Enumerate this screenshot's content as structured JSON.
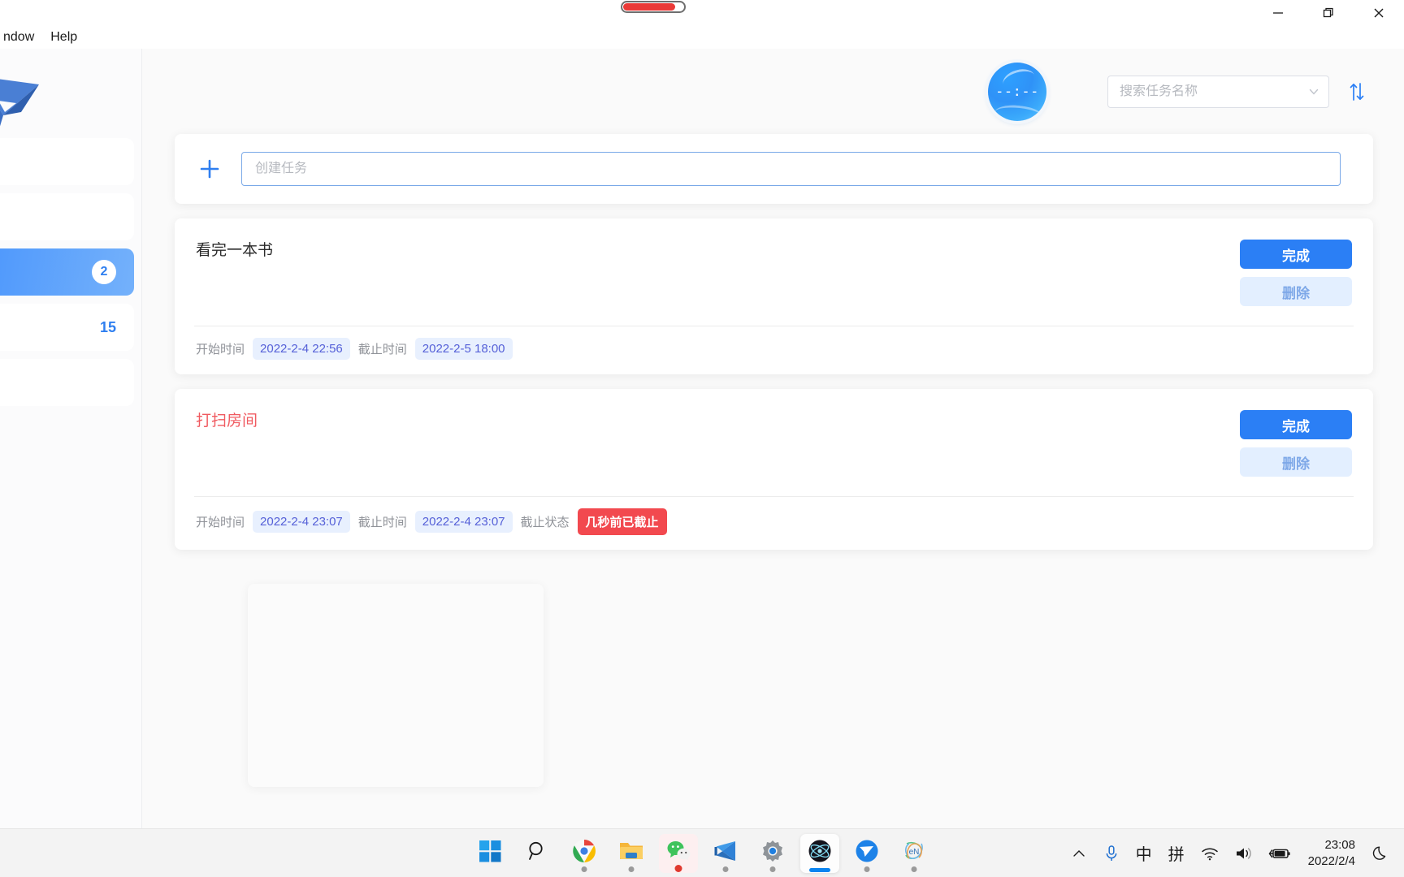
{
  "window": {
    "progress_pill_percent": 80,
    "controls": {
      "minimize": "minimize-icon",
      "restore": "restore-icon",
      "close": "close-icon"
    }
  },
  "menubar": {
    "items": [
      {
        "label": "ndow"
      },
      {
        "label": "Help"
      }
    ]
  },
  "sidebar": {
    "logo": "app-logo",
    "items": [
      {
        "label": "",
        "count": ""
      },
      {
        "label": "",
        "count": ""
      },
      {
        "label": "",
        "count": "2",
        "active": true
      },
      {
        "label": "",
        "count": "15"
      },
      {
        "label": "",
        "count": ""
      }
    ]
  },
  "topbar": {
    "clock_time": "--:--",
    "search": {
      "value": "",
      "placeholder": "搜索任务名称"
    },
    "sort_icon": "sort-arrows-icon",
    "chevron_icon": "chevron-down-icon"
  },
  "create": {
    "plus_icon": "plus-icon",
    "input_value": "",
    "input_placeholder": "创建任务"
  },
  "tasks": [
    {
      "title": "看完一本书",
      "overdue": false,
      "complete_label": "完成",
      "delete_label": "删除",
      "start_label": "开始时间",
      "start_value": "2022-2-4 22:56",
      "due_label": "截止时间",
      "due_value": "2022-2-5 18:00",
      "status_label": "",
      "status_value": ""
    },
    {
      "title": "打扫房间",
      "overdue": true,
      "complete_label": "完成",
      "delete_label": "删除",
      "start_label": "开始时间",
      "start_value": "2022-2-4 23:07",
      "due_label": "截止时间",
      "due_value": "2022-2-4 23:07",
      "status_label": "截止状态",
      "status_value": "几秒前已截止"
    }
  ],
  "taskbar": {
    "items": [
      {
        "name": "start-button",
        "icon": "windows-logo-icon",
        "indicator": "none"
      },
      {
        "name": "search-taskbar-button",
        "icon": "search-icon",
        "indicator": "none"
      },
      {
        "name": "chrome-button",
        "icon": "chrome-icon",
        "indicator": "dot"
      },
      {
        "name": "file-explorer-button",
        "icon": "folder-icon",
        "indicator": "dot"
      },
      {
        "name": "wechat-button",
        "icon": "wechat-icon",
        "indicator": "red-dot"
      },
      {
        "name": "vscode-button",
        "icon": "vscode-icon",
        "indicator": "dot"
      },
      {
        "name": "settings-button",
        "icon": "gear-icon",
        "indicator": "dot"
      },
      {
        "name": "electron-app-button",
        "icon": "electron-icon",
        "indicator": "active-bar"
      },
      {
        "name": "bird-app-button",
        "icon": "bird-icon",
        "indicator": "dot"
      },
      {
        "name": "net-app-button",
        "icon": "knot-icon",
        "indicator": "dot"
      }
    ],
    "tray": {
      "overflow_icon": "chevron-up-icon",
      "mic_icon": "microphone-icon",
      "ime_mode": "中",
      "ime_pinyin": "拼",
      "wifi_icon": "wifi-icon",
      "volume_icon": "speaker-icon",
      "battery_icon": "battery-charging-icon",
      "time": "23:08",
      "date": "2022/2/4",
      "notification_icon": "moon-icon"
    }
  },
  "colors": {
    "accent": "#2b7ff5",
    "accent_soft": "#e3efff",
    "danger": "#f2494f",
    "overdue_text": "#f05a60",
    "meta_value_text": "#5560d8",
    "meta_value_bg": "#e8f0fe"
  }
}
